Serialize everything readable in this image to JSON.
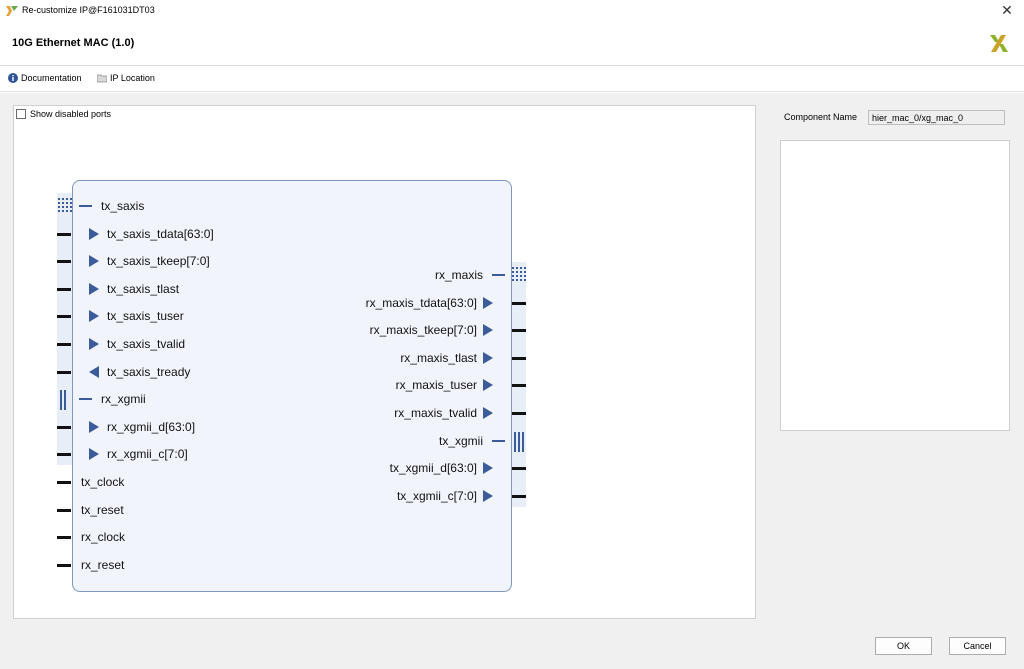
{
  "window": {
    "title": "Re-customize IP@F161031DT03",
    "close_glyph": "✕"
  },
  "header": {
    "ip_title": "10G Ethernet MAC (1.0)",
    "logo_icon": "xilinx-logo-icon"
  },
  "toolbar": {
    "documentation_label": "Documentation",
    "ip_location_label": "IP Location"
  },
  "canvas": {
    "show_disabled_ports_label": "Show disabled ports",
    "show_disabled_ports_checked": false,
    "left_ports": [
      {
        "label": "tx_saxis",
        "kind": "bus",
        "icon": "axis-interface-icon"
      },
      {
        "label": "tx_saxis_tdata[63:0]",
        "kind": "in"
      },
      {
        "label": "tx_saxis_tkeep[7:0]",
        "kind": "in"
      },
      {
        "label": "tx_saxis_tlast",
        "kind": "in"
      },
      {
        "label": "tx_saxis_tuser",
        "kind": "in"
      },
      {
        "label": "tx_saxis_tvalid",
        "kind": "in"
      },
      {
        "label": "tx_saxis_tready",
        "kind": "out"
      },
      {
        "label": "rx_xgmii",
        "kind": "bus",
        "icon": "xgmii-interface-icon"
      },
      {
        "label": "rx_xgmii_d[63:0]",
        "kind": "in"
      },
      {
        "label": "rx_xgmii_c[7:0]",
        "kind": "in"
      },
      {
        "label": "tx_clock",
        "kind": "plain"
      },
      {
        "label": "tx_reset",
        "kind": "plain"
      },
      {
        "label": "rx_clock",
        "kind": "plain"
      },
      {
        "label": "rx_reset",
        "kind": "plain"
      }
    ],
    "right_ports": [
      {
        "label": "rx_maxis",
        "kind": "bus",
        "icon": "axis-interface-icon"
      },
      {
        "label": "rx_maxis_tdata[63:0]",
        "kind": "out"
      },
      {
        "label": "rx_maxis_tkeep[7:0]",
        "kind": "out"
      },
      {
        "label": "rx_maxis_tlast",
        "kind": "out"
      },
      {
        "label": "rx_maxis_tuser",
        "kind": "out"
      },
      {
        "label": "rx_maxis_tvalid",
        "kind": "out"
      },
      {
        "label": "tx_xgmii",
        "kind": "bus",
        "icon": "xgmii-interface-icon"
      },
      {
        "label": "tx_xgmii_d[63:0]",
        "kind": "out"
      },
      {
        "label": "tx_xgmii_c[7:0]",
        "kind": "out"
      }
    ]
  },
  "component": {
    "label": "Component Name",
    "value": "hier_mac_0/xg_mac_0"
  },
  "footer": {
    "ok_label": "OK",
    "cancel_label": "Cancel"
  },
  "colors": {
    "accent": "#3b5c99",
    "block_fill": "#f1f5fb",
    "block_border": "#7f97bf"
  }
}
